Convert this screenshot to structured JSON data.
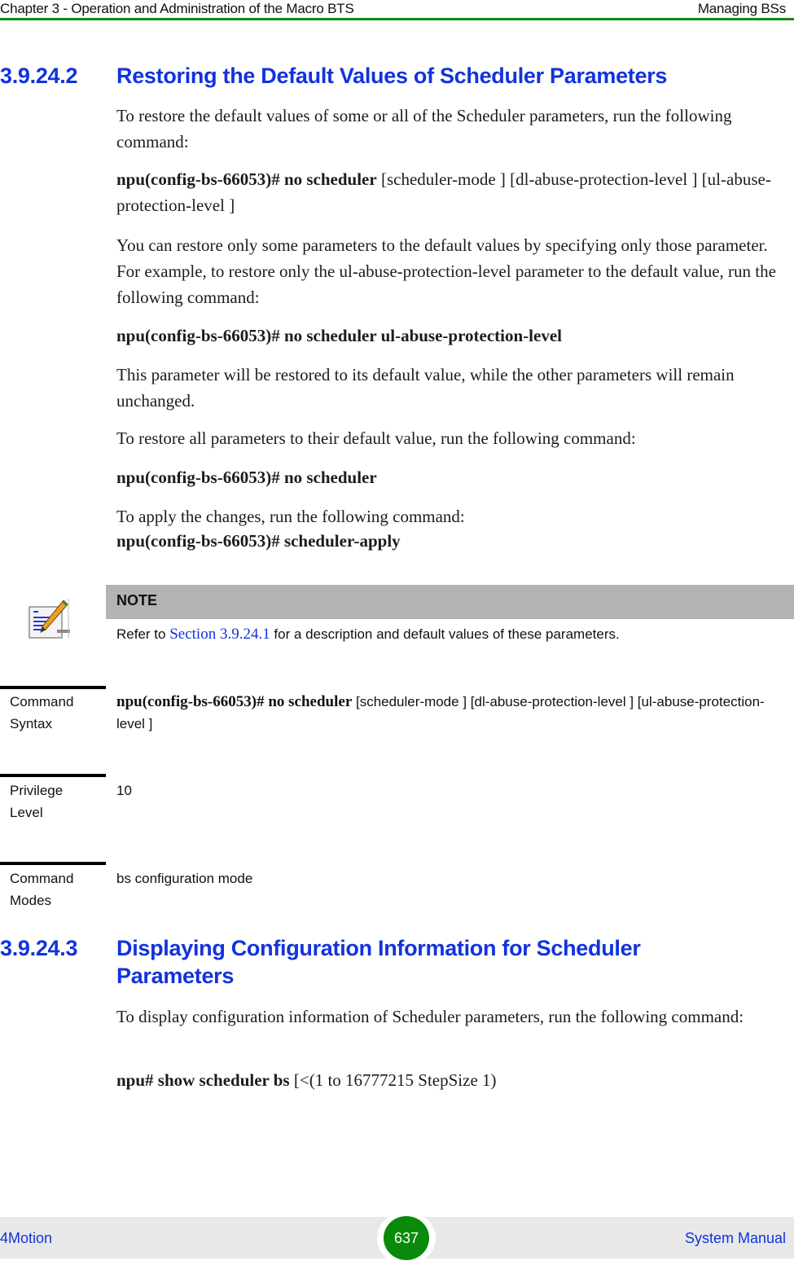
{
  "header": {
    "chapter": "Chapter 3 - Operation and Administration of the Macro BTS",
    "section": "Managing BSs"
  },
  "section_1": {
    "number": "3.9.24.2",
    "title": "Restoring the Default Values of Scheduler Parameters",
    "para1": "To restore the default values of some or all of the Scheduler parameters, run the following command:",
    "cmd1_bold": "npu(config-bs-66053)# no scheduler",
    "cmd1_rest": " [scheduler-mode ] [dl-abuse-protection-level ] [ul-abuse-protection-level ]",
    "para2": "You can restore only some parameters to the default values by specifying only those parameter. For example, to restore only the ul-abuse-protection-level parameter to the default value, run the following command:",
    "cmd2": "npu(config-bs-66053)# no scheduler ul-abuse-protection-level",
    "para3": "This parameter will be restored to its default value, while the other parameters will remain unchanged.",
    "para4": "To restore all parameters to their default value, run the following command:",
    "cmd3": "npu(config-bs-66053)# no scheduler",
    "para5": "To apply the changes, run the following command:",
    "cmd4": "npu(config-bs-66053)# scheduler-apply"
  },
  "note": {
    "icon": "note-pencil-icon",
    "label": "NOTE",
    "text_before": "Refer to ",
    "link": "Section 3.9.24.1",
    "text_after": " for a description and default values of these parameters."
  },
  "command_info": {
    "syntax_label": "Command Syntax",
    "syntax_bold": "npu(config-bs-66053)# no scheduler",
    "syntax_rest": " [scheduler-mode ] [dl-abuse-protection-level ] [ul-abuse-protection-level ]",
    "privilege_label": "Privilege Level",
    "privilege_value": "10",
    "modes_label": "Command Modes",
    "modes_value": "bs configuration mode"
  },
  "section_2": {
    "number": "3.9.24.3",
    "title": "Displaying Configuration Information for Scheduler Parameters",
    "para1": "To display configuration information of Scheduler parameters, run the following command:",
    "cmd_bold": "npu# show scheduler bs",
    "cmd_rest": " [<(1 to 16777215 StepSize 1)"
  },
  "footer": {
    "product": "4Motion",
    "page": "637",
    "manual": "System Manual"
  }
}
